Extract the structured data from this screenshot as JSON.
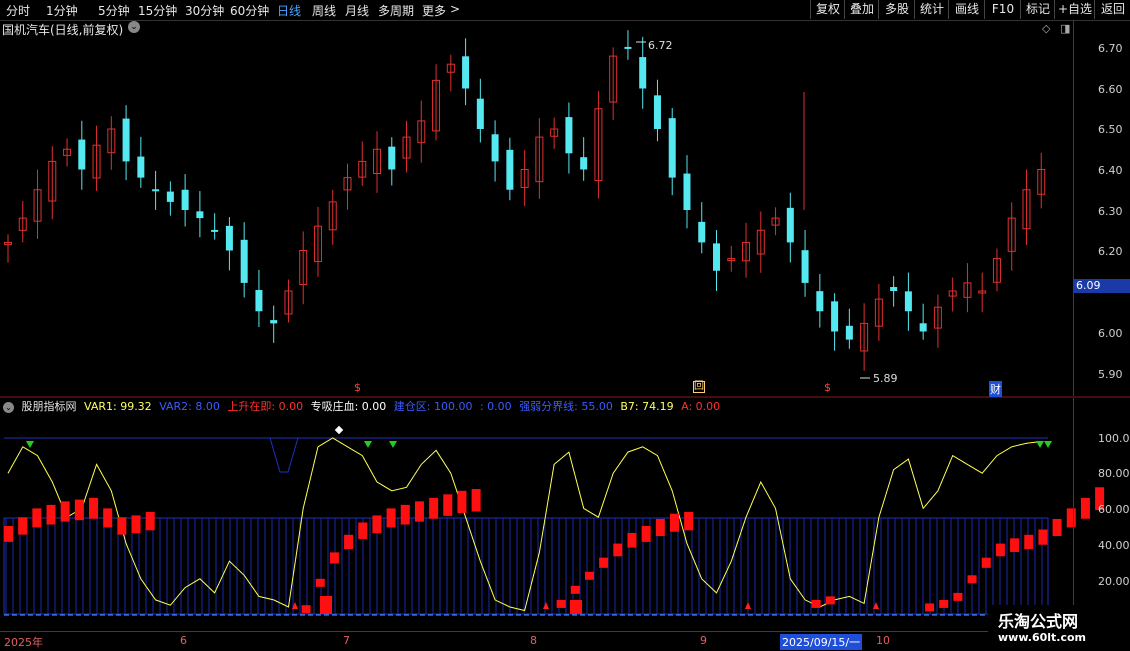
{
  "toolbar": {
    "periods": [
      "分时",
      "1分钟",
      "5分钟",
      "15分钟",
      "30分钟",
      "60分钟",
      "日线",
      "周线",
      "月线",
      "多周期",
      "更多"
    ],
    "active": "日线",
    "more_arrow": ">",
    "buttons": [
      "复权",
      "叠加",
      "多股",
      "统计",
      "画线",
      "F10",
      "标记",
      "+自选",
      "返回"
    ]
  },
  "chart_title": "国机汽车(日线,前复权)",
  "title_icon": "chevron-down-icon",
  "price_axis": [
    "6.70",
    "6.60",
    "6.50",
    "6.40",
    "6.30",
    "6.20",
    "6.10",
    "6.00",
    "5.90"
  ],
  "current_price": "6.09",
  "high_label": "6.72",
  "low_label": "5.89",
  "event_marks": [
    "$",
    "回",
    "$",
    "财"
  ],
  "indicator": {
    "name": "股朋指标网",
    "items": [
      {
        "label": "VAR1: 99.32",
        "color": "#ffff66"
      },
      {
        "label": "VAR2: 8.00",
        "color": "#3a5bff"
      },
      {
        "label": "上升在即: 0.00",
        "color": "#ff3030"
      },
      {
        "label": "专吸庄血: 0.00",
        "color": "#ffffff"
      },
      {
        "label": "建仓区: 100.00",
        "color": "#3a5bff"
      },
      {
        "label": ": 0.00",
        "color": "#3a5bff"
      },
      {
        "label": "强弱分界线: 55.00",
        "color": "#3a5bff"
      },
      {
        "label": "B7: 74.19",
        "color": "#ffff66"
      },
      {
        "label": "A: 0.00",
        "color": "#ff3030"
      }
    ],
    "axis": [
      "100.0",
      "80.00",
      "60.00",
      "40.00",
      "20.00"
    ]
  },
  "date_axis": [
    "2025年",
    "6",
    "7",
    "8",
    "9",
    "2025/09/15/一",
    "10"
  ],
  "watermark": {
    "name": "乐淘公式网",
    "url": "www.60lt.com"
  },
  "colors": {
    "up": "#e03030",
    "down": "#54e8f0",
    "axis": "#8b1a1a",
    "line": "#ffff40",
    "blue": "#2030c0"
  }
}
